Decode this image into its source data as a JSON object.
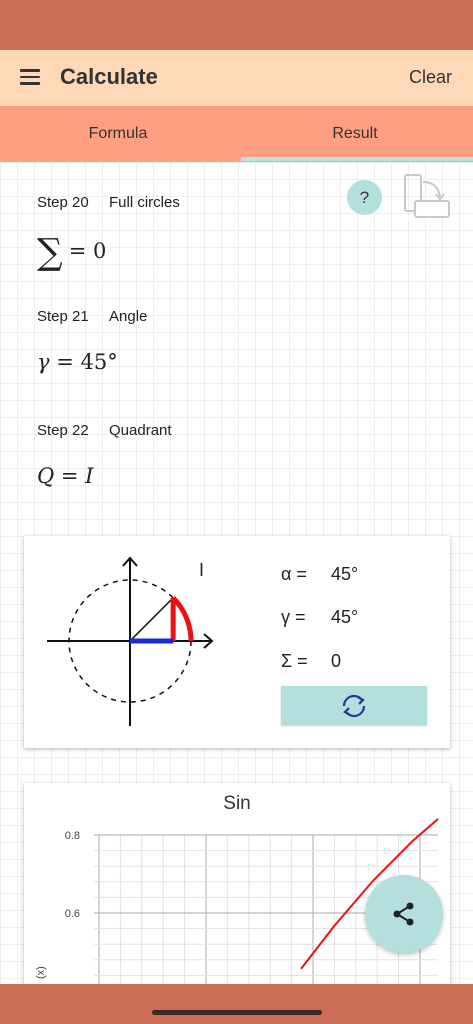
{
  "app_bar": {
    "title": "Calculate",
    "clear_label": "Clear"
  },
  "tabs": [
    {
      "label": "Formula"
    },
    {
      "label": "Result"
    }
  ],
  "steps": [
    {
      "step": "Step 20",
      "name": "Full circles",
      "formula_lhs": "∑",
      "formula_rhs": "= 0"
    },
    {
      "step": "Step 21",
      "name": "Angle",
      "formula_lhs": "γ",
      "formula_rhs": "= 45°"
    },
    {
      "step": "Step 22",
      "name": "Quadrant",
      "formula_lhs": "Q",
      "formula_rhs": "= I"
    }
  ],
  "help": {
    "label": "?"
  },
  "unit_circle": {
    "quadrant": "I",
    "angle_deg": 45,
    "values": [
      {
        "label": "α =",
        "value": "45°"
      },
      {
        "label": "γ =",
        "value": "45°"
      },
      {
        "label": "Σ =",
        "value": "0"
      }
    ],
    "colors": {
      "arc": "#ee1111",
      "cosine": "#1a2bd6",
      "axis": "#111111"
    }
  },
  "chart_data": {
    "type": "line",
    "title": "Sin",
    "ylabel": "(x)",
    "yticks": [
      "0.8",
      "0.6"
    ],
    "ylim": [
      0.4,
      0.8
    ],
    "x": [
      0.475,
      0.6,
      0.75,
      0.9,
      1.0
    ],
    "series": [
      {
        "values": [
          0.457,
          0.565,
          0.682,
          0.783,
          0.841
        ]
      }
    ],
    "xlim": [
      -0.3,
      1.0
    ],
    "grid": true,
    "line_color": "#ee1111"
  },
  "icons": {
    "menu": "menu-icon",
    "rotate": "rotate-screen-icon",
    "refresh": "refresh-icon",
    "share": "share-icon"
  }
}
